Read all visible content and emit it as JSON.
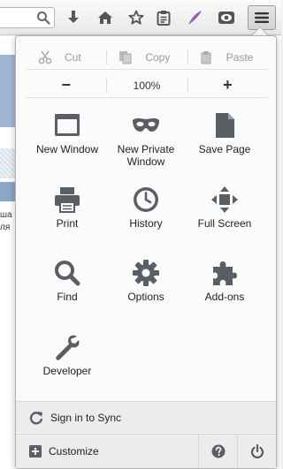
{
  "toolbar": {
    "buttons": [
      {
        "name": "downloads",
        "icon": "download-icon"
      },
      {
        "name": "home",
        "icon": "home-icon"
      },
      {
        "name": "bookmarks",
        "icon": "star-icon"
      },
      {
        "name": "bookmarks-list",
        "icon": "clipboard-icon"
      },
      {
        "name": "feather",
        "icon": "feather-icon"
      },
      {
        "name": "pocket",
        "icon": "eye-icon"
      }
    ],
    "menu_icon": "hamburger-icon"
  },
  "background_page": {
    "text_line1": "ша",
    "text_line2": "ля"
  },
  "panel": {
    "edit": {
      "cut_label": "Cut",
      "copy_label": "Copy",
      "paste_label": "Paste"
    },
    "zoom": {
      "minus_label": "−",
      "level": "100%",
      "plus_label": "+"
    },
    "items": [
      {
        "id": "new-window",
        "label": "New Window",
        "icon": "window-icon"
      },
      {
        "id": "new-private-window",
        "label": "New Private Window",
        "icon": "mask-icon"
      },
      {
        "id": "save-page",
        "label": "Save Page",
        "icon": "page-icon"
      },
      {
        "id": "print",
        "label": "Print",
        "icon": "printer-icon"
      },
      {
        "id": "history",
        "label": "History",
        "icon": "clock-icon"
      },
      {
        "id": "full-screen",
        "label": "Full Screen",
        "icon": "fullscreen-icon"
      },
      {
        "id": "find",
        "label": "Find",
        "icon": "magnifier-icon"
      },
      {
        "id": "options",
        "label": "Options",
        "icon": "gear-icon"
      },
      {
        "id": "add-ons",
        "label": "Add-ons",
        "icon": "puzzle-icon"
      },
      {
        "id": "developer",
        "label": "Developer",
        "icon": "wrench-icon"
      }
    ],
    "sync_label": "Sign in to Sync",
    "customize_label": "Customize",
    "help_icon": "help-icon",
    "quit_icon": "power-icon"
  },
  "colors": {
    "icon_gray": "#5a5f66",
    "feather_purple": "#8e5bbf",
    "panel_bg": "#fbfbfb",
    "footer_bg": "#ececec"
  }
}
